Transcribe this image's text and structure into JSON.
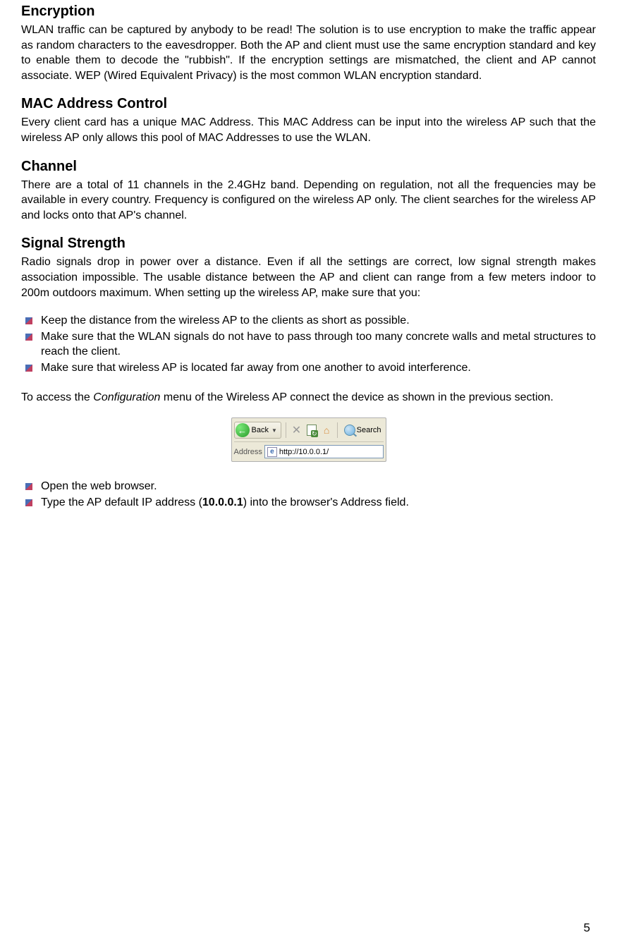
{
  "sections": {
    "encryption": {
      "heading": "Encryption",
      "body": "WLAN traffic can be captured by anybody to be read! The solution is to use encryption to make the traffic appear as random characters to the eavesdropper. Both the AP and client must use the same encryption standard and key to enable them to decode the \"rubbish\". If the encryption settings are mismatched, the client and AP cannot associate. WEP (Wired Equivalent Privacy) is the most common WLAN encryption standard."
    },
    "mac": {
      "heading": "MAC Address Control",
      "body": "Every client card has a unique MAC Address. This MAC Address can be input into the wireless AP such that the wireless AP only allows this pool of MAC Addresses to use the WLAN."
    },
    "channel": {
      "heading": "Channel",
      "body": "There are a total of 11 channels in the 2.4GHz band. Depending on regulation, not all the frequencies may be available in every country. Frequency is configured on the wireless AP only. The client searches for the wireless AP and locks onto that AP's channel."
    },
    "signal": {
      "heading": "Signal Strength",
      "body": "Radio signals drop in power over a distance. Even if all the settings are correct, low signal strength makes association impossible.  The usable distance between the AP and client can range from a few meters indoor to 200m outdoors maximum. When setting up the wireless AP, make sure that you:",
      "bullets": [
        "Keep the distance from the wireless AP to the clients as short as possible.",
        "Make sure that the WLAN signals do not have to pass through too many concrete walls and metal structures to reach the client.",
        "Make sure that wireless AP is located far away from one another to avoid interference."
      ]
    }
  },
  "access": {
    "pre": "To access the ",
    "italic": "Configuration",
    "post": " menu of the Wireless AP connect the device as shown in the previous section.",
    "bullets": [
      {
        "text": "Open the web browser."
      },
      {
        "pre": "Type the AP default IP address (",
        "bold": "10.0.0.1",
        "post": ") into the browser's Address field."
      }
    ]
  },
  "browser": {
    "back_label": "Back",
    "search_label": "Search",
    "address_label": "Address",
    "address_value": "http://10.0.0.1/"
  },
  "page_number": "5"
}
